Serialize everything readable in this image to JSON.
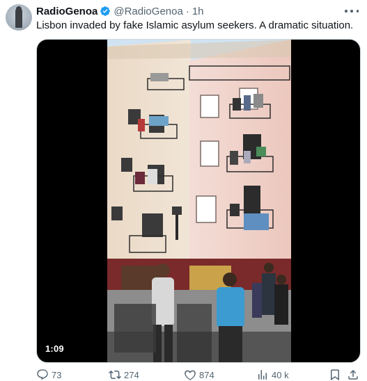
{
  "tweet": {
    "author_name": "RadioGenoa",
    "author_handle": "@RadioGenoa",
    "separator": "·",
    "time": "1h",
    "text": "Lisbon invaded by fake Islamic asylum seekers. A dramatic situation.",
    "video_duration": "1:09"
  },
  "actions": {
    "replies": "73",
    "reposts": "274",
    "likes": "874",
    "views": "40 k"
  },
  "colors": {
    "verified": "#1d9bf0",
    "secondary_text": "#536471",
    "primary_text": "#0f1419"
  },
  "icons": [
    "verified-badge-icon",
    "more-icon",
    "reply-icon",
    "repost-icon",
    "like-icon",
    "views-icon",
    "bookmark-icon",
    "share-icon"
  ]
}
